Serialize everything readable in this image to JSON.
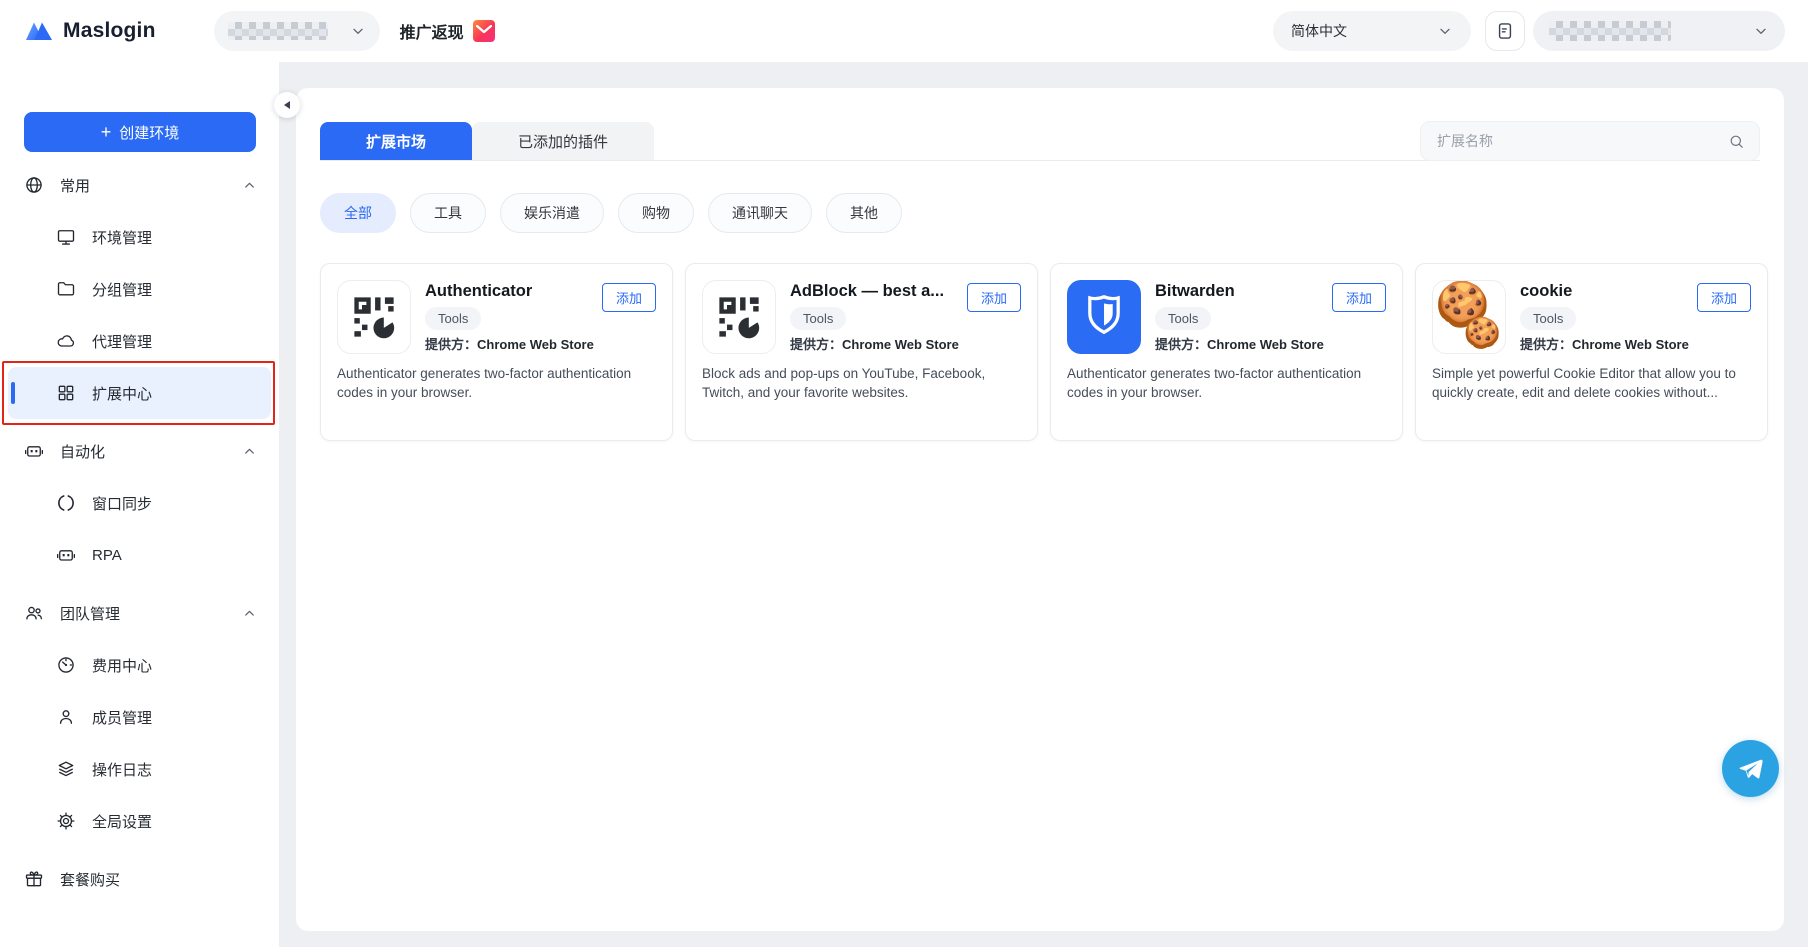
{
  "header": {
    "brand": "Maslogin",
    "promo_label": "推广返现",
    "language_selector": "简体中文"
  },
  "sidebar": {
    "create_env_label": "创建环境",
    "sections": [
      {
        "key": "common",
        "label": "常用",
        "icon": "globe",
        "items": [
          {
            "key": "env-management",
            "label": "环境管理",
            "icon": "monitor",
            "active": false
          },
          {
            "key": "group-management",
            "label": "分组管理",
            "icon": "folder",
            "active": false
          },
          {
            "key": "proxy-management",
            "label": "代理管理",
            "icon": "cloud",
            "active": false
          },
          {
            "key": "extension-center",
            "label": "扩展中心",
            "icon": "grid",
            "active": true,
            "annotated": true
          }
        ]
      },
      {
        "key": "automation",
        "label": "自动化",
        "icon": "robot",
        "items": [
          {
            "key": "window-sync",
            "label": "窗口同步",
            "icon": "sync",
            "active": false
          },
          {
            "key": "rpa",
            "label": "RPA",
            "icon": "robot",
            "active": false
          }
        ]
      },
      {
        "key": "team-management",
        "label": "团队管理",
        "icon": "users",
        "items": [
          {
            "key": "billing-center",
            "label": "费用中心",
            "icon": "gauge",
            "active": false
          },
          {
            "key": "member-management",
            "label": "成员管理",
            "icon": "person",
            "active": false
          },
          {
            "key": "operation-logs",
            "label": "操作日志",
            "icon": "layers",
            "active": false
          },
          {
            "key": "global-settings",
            "label": "全局设置",
            "icon": "gear",
            "active": false
          }
        ]
      }
    ],
    "footer_item": {
      "key": "plan-purchase",
      "label": "套餐购买",
      "icon": "gift"
    }
  },
  "main": {
    "tabs": [
      {
        "key": "market",
        "label": "扩展市场",
        "active": true
      },
      {
        "key": "installed",
        "label": "已添加的插件",
        "active": false
      }
    ],
    "search": {
      "placeholder": "扩展名称"
    },
    "filters": [
      {
        "key": "all",
        "label": "全部",
        "active": true
      },
      {
        "key": "tools",
        "label": "工具",
        "active": false
      },
      {
        "key": "entertainment",
        "label": "娱乐消遣",
        "active": false
      },
      {
        "key": "shopping",
        "label": "购物",
        "active": false
      },
      {
        "key": "communication",
        "label": "通讯聊天",
        "active": false
      },
      {
        "key": "other",
        "label": "其他",
        "active": false
      }
    ],
    "cards": [
      {
        "key": "authenticator",
        "title": "Authenticator",
        "tag": "Tools",
        "provider_label": "提供方：",
        "provider": "Chrome Web Store",
        "description": "Authenticator generates two-factor authentication codes in your browser.",
        "add_label": "添加",
        "icon": "qr"
      },
      {
        "key": "adblock",
        "title": "AdBlock — best a...",
        "tag": "Tools",
        "provider_label": "提供方：",
        "provider": "Chrome Web Store",
        "description": "Block ads and pop-ups on YouTube, Facebook, Twitch, and your favorite websites.",
        "add_label": "添加",
        "icon": "qr"
      },
      {
        "key": "bitwarden",
        "title": "Bitwarden",
        "tag": "Tools",
        "provider_label": "提供方：",
        "provider": "Chrome Web Store",
        "description": "Authenticator generates two-factor authentication codes in your browser.",
        "add_label": "添加",
        "icon": "bitwarden"
      },
      {
        "key": "cookie",
        "title": "cookie",
        "tag": "Tools",
        "provider_label": "提供方：",
        "provider": "Chrome Web Store",
        "description": "Simple yet powerful Cookie Editor that allow you to quickly create, edit and delete cookies without...",
        "add_label": "添加",
        "icon": "cookie"
      }
    ]
  },
  "colors": {
    "accent": "#2a6af5",
    "active_pill_bg": "#e4ecfd",
    "sidebar_active_bg": "#eaf1fe",
    "annotation_red": "#e12619",
    "page_bg": "#edeff3",
    "telegram_blue": "#2ba3e3",
    "bitwarden_blue": "#2b6cf5"
  }
}
